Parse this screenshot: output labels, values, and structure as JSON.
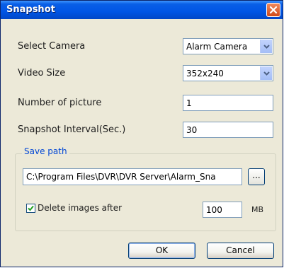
{
  "window": {
    "title": "Snapshot"
  },
  "form": {
    "select_camera": {
      "label": "Select Camera",
      "value": "Alarm Camera"
    },
    "video_size": {
      "label": "Video Size",
      "value": "352x240"
    },
    "number_of_picture": {
      "label": "Number of picture",
      "value": "1"
    },
    "snapshot_interval": {
      "label": "Snapshot Interval(Sec.)",
      "value": "30"
    }
  },
  "save_path": {
    "group_label": "Save path",
    "path_value": "C:\\Program Files\\DVR\\DVR Server\\Alarm_Sna",
    "browse_label": "...",
    "delete_checkbox_label": "Delete images after",
    "delete_checked": true,
    "delete_size_value": "100",
    "size_unit": "MB"
  },
  "buttons": {
    "ok_label": "OK",
    "cancel_label": "Cancel"
  },
  "icons": {
    "close": "close-icon",
    "dropdown": "chevron-down-icon",
    "check": "checkmark-icon"
  },
  "colors": {
    "titlebar": "#0055e5",
    "close_button": "#d04a19",
    "group_title": "#0046d5",
    "dialog_background": "#ece9d8"
  }
}
